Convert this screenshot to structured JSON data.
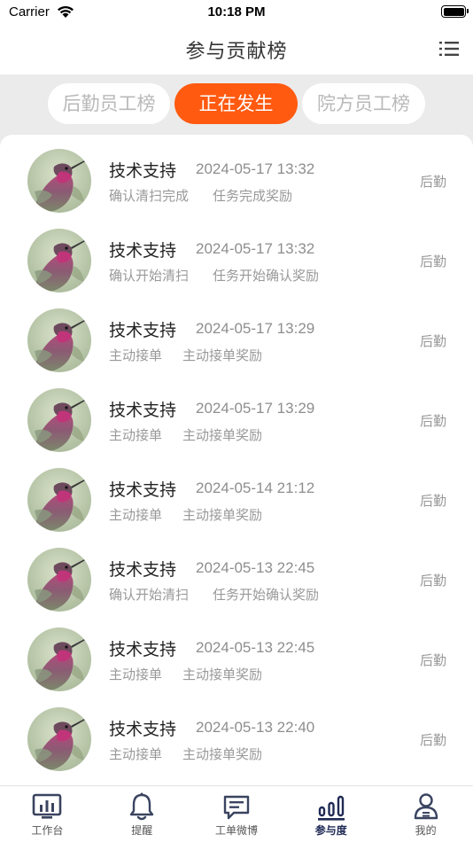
{
  "status_bar": {
    "carrier": "Carrier",
    "time": "10:18 PM"
  },
  "nav": {
    "title": "参与贡献榜",
    "menu_icon": "list-menu-icon"
  },
  "tabs": [
    {
      "label": "后勤员工榜",
      "active": false
    },
    {
      "label": "正在发生",
      "active": true
    },
    {
      "label": "院方员工榜",
      "active": false
    }
  ],
  "records": [
    {
      "name": "技术支持",
      "time": "2024-05-17 13:32",
      "action": "确认清扫完成",
      "reward": "任务完成奖励",
      "role": "后勤"
    },
    {
      "name": "技术支持",
      "time": "2024-05-17 13:32",
      "action": "确认开始清扫",
      "reward": "任务开始确认奖励",
      "role": "后勤"
    },
    {
      "name": "技术支持",
      "time": "2024-05-17 13:29",
      "action": "主动接单",
      "reward": "主动接单奖励",
      "role": "后勤"
    },
    {
      "name": "技术支持",
      "time": "2024-05-17 13:29",
      "action": "主动接单",
      "reward": "主动接单奖励",
      "role": "后勤"
    },
    {
      "name": "技术支持",
      "time": "2024-05-14 21:12",
      "action": "主动接单",
      "reward": "主动接单奖励",
      "role": "后勤"
    },
    {
      "name": "技术支持",
      "time": "2024-05-13 22:45",
      "action": "确认开始清扫",
      "reward": "任务开始确认奖励",
      "role": "后勤"
    },
    {
      "name": "技术支持",
      "time": "2024-05-13 22:45",
      "action": "主动接单",
      "reward": "主动接单奖励",
      "role": "后勤"
    },
    {
      "name": "技术支持",
      "time": "2024-05-13 22:40",
      "action": "主动接单",
      "reward": "主动接单奖励",
      "role": "后勤"
    }
  ],
  "tab_bar": [
    {
      "label": "工作台",
      "icon": "dashboard-icon",
      "active": false
    },
    {
      "label": "提醒",
      "icon": "bell-icon",
      "active": false
    },
    {
      "label": "工单微博",
      "icon": "chat-icon",
      "active": false
    },
    {
      "label": "参与度",
      "icon": "bar-chart-icon",
      "active": true
    },
    {
      "label": "我的",
      "icon": "profile-icon",
      "active": false
    }
  ],
  "colors": {
    "accent": "#ff5a10",
    "active_tab_text": "#1f2a55",
    "background": "#ebebeb"
  }
}
